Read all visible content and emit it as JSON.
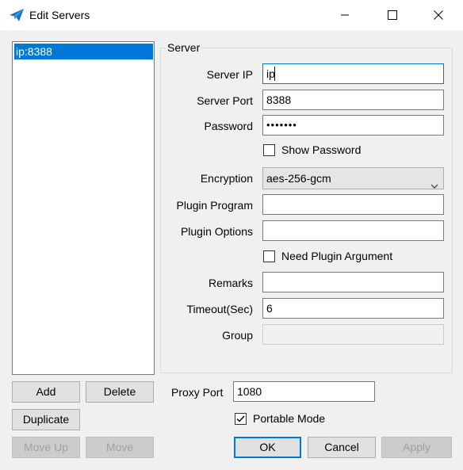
{
  "window": {
    "title": "Edit Servers",
    "icon": "paper-plane-icon",
    "controls": [
      "minimize-icon",
      "maximize-icon",
      "close-icon"
    ]
  },
  "server_list": {
    "items": [
      {
        "label": "ip:8388",
        "selected": true
      }
    ]
  },
  "server_group": {
    "legend": "Server",
    "fields": {
      "server_ip": {
        "label": "Server IP",
        "value": "ip"
      },
      "server_port": {
        "label": "Server Port",
        "value": "8388"
      },
      "password": {
        "label": "Password",
        "value": "•••••••"
      },
      "show_password": {
        "label": "Show Password",
        "checked": false
      },
      "encryption": {
        "label": "Encryption",
        "value": "aes-256-gcm"
      },
      "plugin_program": {
        "label": "Plugin Program",
        "value": ""
      },
      "plugin_options": {
        "label": "Plugin Options",
        "value": ""
      },
      "need_plugin_argument": {
        "label": "Need Plugin Argument",
        "checked": false
      },
      "remarks": {
        "label": "Remarks",
        "value": ""
      },
      "timeout": {
        "label": "Timeout(Sec)",
        "value": "6"
      },
      "group": {
        "label": "Group",
        "value": ""
      }
    }
  },
  "buttons": {
    "add": "Add",
    "delete": "Delete",
    "duplicate": "Duplicate",
    "move_up": "Move Up",
    "move": "Move",
    "ok": "OK",
    "cancel": "Cancel",
    "apply": "Apply"
  },
  "proxy": {
    "label": "Proxy Port",
    "value": "1080"
  },
  "portable_mode": {
    "label": "Portable Mode",
    "checked": true
  },
  "colors": {
    "accent": "#0078d7",
    "window_bg": "#f0f0f0"
  }
}
